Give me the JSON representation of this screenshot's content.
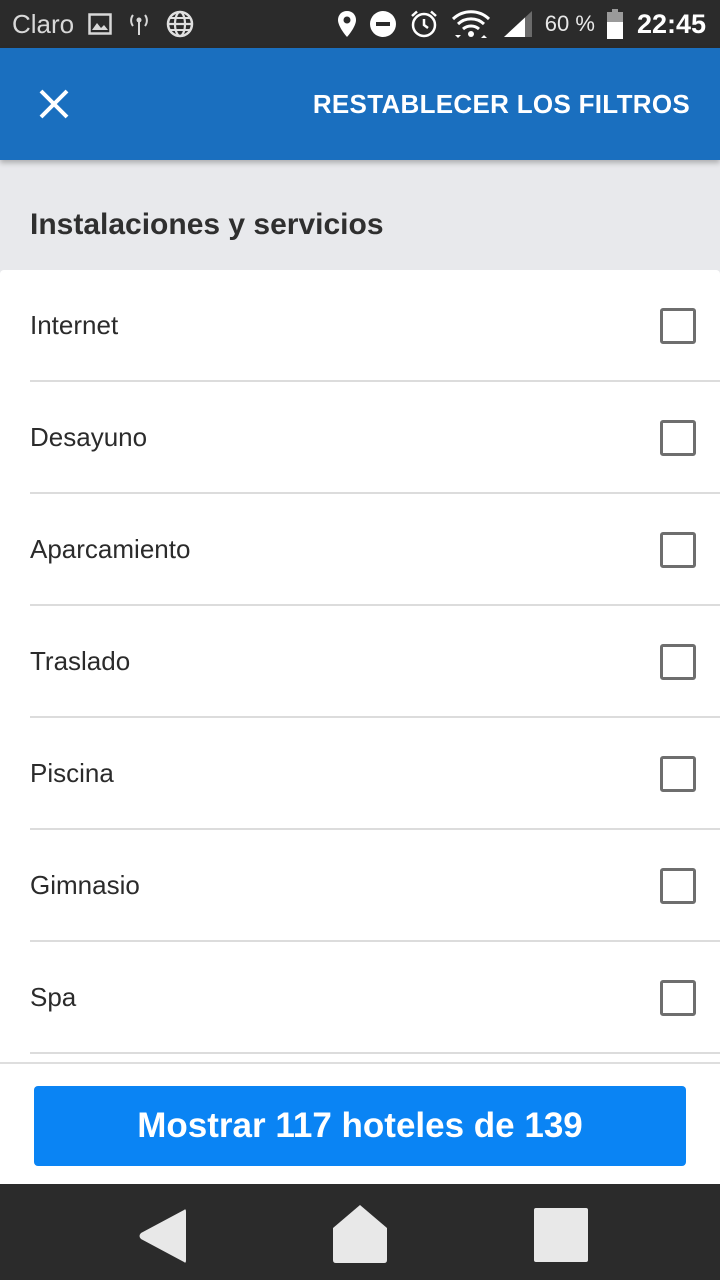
{
  "status_bar": {
    "carrier": "Claro",
    "battery": "60 %",
    "time": "22:45",
    "icons": [
      "image-icon",
      "hotspot-icon",
      "globe-icon",
      "location-icon",
      "do-not-disturb-icon",
      "alarm-icon",
      "wifi-icon",
      "signal-icon",
      "battery-icon"
    ]
  },
  "header": {
    "close_icon": "close-icon",
    "reset_label": "RESTABLECER LOS FILTROS"
  },
  "section": {
    "title": "Instalaciones y servicios"
  },
  "amenities": [
    {
      "label": "Internet",
      "checked": false
    },
    {
      "label": "Desayuno",
      "checked": false
    },
    {
      "label": "Aparcamiento",
      "checked": false
    },
    {
      "label": "Traslado",
      "checked": false
    },
    {
      "label": "Piscina",
      "checked": false
    },
    {
      "label": "Gimnasio",
      "checked": false
    },
    {
      "label": "Spa",
      "checked": false
    }
  ],
  "footer": {
    "show_button_label": "Mostrar 117 hoteles de 139"
  },
  "nav": {
    "back": "back-icon",
    "home": "home-icon",
    "recents": "recents-icon"
  },
  "colors": {
    "app_bar": "#1a6fbf",
    "primary_button": "#0a84f4",
    "background": "#e8e9ec"
  }
}
